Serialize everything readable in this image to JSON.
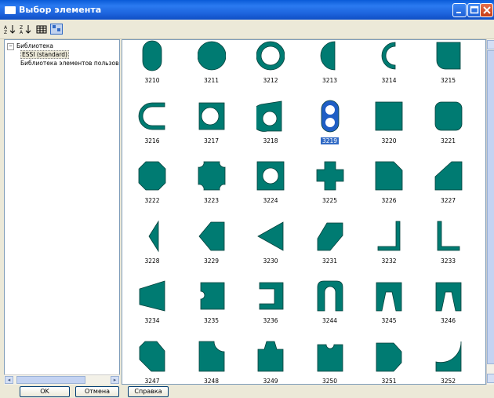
{
  "window": {
    "title": "Выбор элемента"
  },
  "tree": {
    "root": "Библиотека",
    "expander": "−",
    "items": [
      "ESSI (standard)",
      "Библиотека элементов пользов"
    ]
  },
  "elements": [
    "3210",
    "3211",
    "3212",
    "3213",
    "3214",
    "3215",
    "3216",
    "3217",
    "3218",
    "3219",
    "3220",
    "3221",
    "3222",
    "3223",
    "3224",
    "3225",
    "3226",
    "3227",
    "3228",
    "3229",
    "3230",
    "3231",
    "3232",
    "3233",
    "3234",
    "3235",
    "3236",
    "3244",
    "3245",
    "3246",
    "3247",
    "3248",
    "3249",
    "3250",
    "3251",
    "3252"
  ],
  "selected_element": "3219",
  "buttons": {
    "ok": "OK",
    "cancel": "Отмена",
    "help": "Справка"
  },
  "colors": {
    "shape_fill": "#007b72",
    "selection": "#316ac5",
    "titlebar": "#0a5bd8"
  }
}
